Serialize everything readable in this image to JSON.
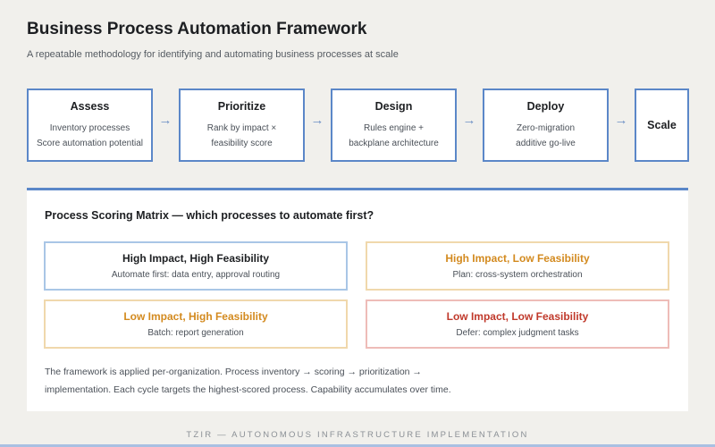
{
  "header": {
    "title": "Business Process Automation Framework",
    "subtitle": "A repeatable methodology for identifying and automating business processes at scale"
  },
  "steps": [
    {
      "title": "Assess",
      "lines": [
        "Inventory processes",
        "Score automation potential"
      ]
    },
    {
      "title": "Prioritize",
      "lines": [
        "Rank by impact ×",
        "feasibility score"
      ]
    },
    {
      "title": "Design",
      "lines": [
        "Rules engine +",
        "backplane architecture"
      ]
    },
    {
      "title": "Deploy",
      "lines": [
        "Zero-migration",
        "additive go-live"
      ]
    },
    {
      "title": "Scale",
      "lines": []
    }
  ],
  "arrow_glyph": "→",
  "matrix": {
    "title": "Process Scoring Matrix — which processes to automate first?",
    "quadrants": [
      {
        "title": "High Impact, High Feasibility",
        "desc": "Automate first: data entry, approval routing",
        "title_color": "#1d1f22",
        "border_color": "#a9c6e6"
      },
      {
        "title": "High Impact, Low Feasibility",
        "desc": "Plan: cross-system orchestration",
        "title_color": "#d38a1f",
        "border_color": "#f0d8ac"
      },
      {
        "title": "Low Impact, High Feasibility",
        "desc": "Batch: report generation",
        "title_color": "#d38a1f",
        "border_color": "#f0d8ac"
      },
      {
        "title": "Low Impact, Low Feasibility",
        "desc": "Defer: complex judgment tasks",
        "title_color": "#c0392b",
        "border_color": "#eebcb8"
      }
    ],
    "footnote_lines": [
      "The framework is applied per-organization. Process inventory → scoring → prioritization →",
      "implementation. Each cycle targets the highest-scored process. Capability accumulates over time."
    ]
  },
  "footer": "TZIR — AUTONOMOUS INFRASTRUCTURE IMPLEMENTATION",
  "colors": {
    "accent": "#5b87c8",
    "background": "#f1f0ec"
  }
}
